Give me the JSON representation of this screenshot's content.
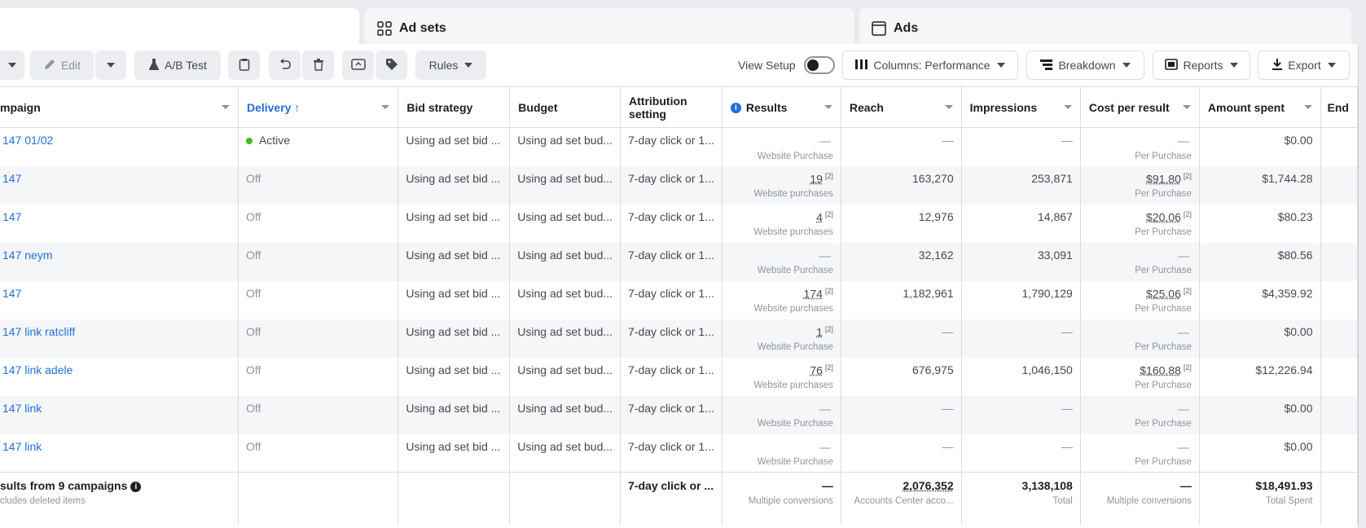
{
  "tabs": {
    "adsets": "Ad sets",
    "ads": "Ads"
  },
  "toolbar": {
    "edit": "Edit",
    "ab_test": "A/B Test",
    "rules": "Rules",
    "view_setup": "View Setup",
    "columns": "Columns: Performance",
    "breakdown": "Breakdown",
    "reports": "Reports",
    "export": "Export"
  },
  "columns": {
    "campaign": "mpaign",
    "delivery": "Delivery",
    "bid_strategy": "Bid strategy",
    "budget": "Budget",
    "attribution": "Attribution setting",
    "results": "Results",
    "reach": "Reach",
    "impressions": "Impressions",
    "cost_per_result": "Cost per result",
    "amount_spent": "Amount spent",
    "ends": "End"
  },
  "rows": [
    {
      "name": "147 01/02",
      "delivery": "Active",
      "bid": "Using ad set bid ...",
      "budget": "Using ad set bud...",
      "attribution": "7-day click or 1...",
      "results": "—",
      "results_sup": "",
      "results_sub": "Website Purchase",
      "reach": "—",
      "impressions": "—",
      "cpr": "—",
      "cpr_sup": "",
      "cpr_sub": "Per Purchase",
      "spent": "$0.00"
    },
    {
      "name": "147",
      "delivery": "Off",
      "bid": "Using ad set bid ...",
      "budget": "Using ad set bud...",
      "attribution": "7-day click or 1...",
      "results": "19",
      "results_sup": "[2]",
      "results_sub": "Website purchases",
      "reach": "163,270",
      "impressions": "253,871",
      "cpr": "$91.80",
      "cpr_sup": "[2]",
      "cpr_sub": "Per Purchase",
      "spent": "$1,744.28"
    },
    {
      "name": "147",
      "delivery": "Off",
      "bid": "Using ad set bid ...",
      "budget": "Using ad set bud...",
      "attribution": "7-day click or 1...",
      "results": "4",
      "results_sup": "[2]",
      "results_sub": "Website purchases",
      "reach": "12,976",
      "impressions": "14,867",
      "cpr": "$20.06",
      "cpr_sup": "[2]",
      "cpr_sub": "Per Purchase",
      "spent": "$80.23"
    },
    {
      "name": "147 neym",
      "delivery": "Off",
      "bid": "Using ad set bid ...",
      "budget": "Using ad set bud...",
      "attribution": "7-day click or 1...",
      "results": "—",
      "results_sup": "",
      "results_sub": "Website Purchase",
      "reach": "32,162",
      "impressions": "33,091",
      "cpr": "—",
      "cpr_sup": "",
      "cpr_sub": "Per Purchase",
      "spent": "$80.56"
    },
    {
      "name": "147",
      "delivery": "Off",
      "bid": "Using ad set bid ...",
      "budget": "Using ad set bud...",
      "attribution": "7-day click or 1...",
      "results": "174",
      "results_sup": "[2]",
      "results_sub": "Website purchases",
      "reach": "1,182,961",
      "impressions": "1,790,129",
      "cpr": "$25.06",
      "cpr_sup": "[2]",
      "cpr_sub": "Per Purchase",
      "spent": "$4,359.92"
    },
    {
      "name": "147 link ratcliff",
      "delivery": "Off",
      "bid": "Using ad set bid ...",
      "budget": "Using ad set bud...",
      "attribution": "7-day click or 1...",
      "results": "1",
      "results_sup": "[2]",
      "results_sub": "Website Purchase",
      "reach": "—",
      "impressions": "—",
      "cpr": "—",
      "cpr_sup": "",
      "cpr_sub": "Per Purchase",
      "spent": "$0.00"
    },
    {
      "name": "147 link adele",
      "delivery": "Off",
      "bid": "Using ad set bid ...",
      "budget": "Using ad set bud...",
      "attribution": "7-day click or 1...",
      "results": "76",
      "results_sup": "[2]",
      "results_sub": "Website purchases",
      "reach": "676,975",
      "impressions": "1,046,150",
      "cpr": "$160.88",
      "cpr_sup": "[2]",
      "cpr_sub": "Per Purchase",
      "spent": "$12,226.94"
    },
    {
      "name": "147 link",
      "delivery": "Off",
      "bid": "Using ad set bid ...",
      "budget": "Using ad set bud...",
      "attribution": "7-day click or 1...",
      "results": "—",
      "results_sup": "",
      "results_sub": "Website Purchase",
      "reach": "—",
      "impressions": "—",
      "cpr": "—",
      "cpr_sup": "",
      "cpr_sub": "Per Purchase",
      "spent": "$0.00"
    },
    {
      "name": "147 link",
      "delivery": "Off",
      "bid": "Using ad set bid ...",
      "budget": "Using ad set bud...",
      "attribution": "7-day click or 1...",
      "results": "—",
      "results_sup": "",
      "results_sub": "Website Purchase",
      "reach": "—",
      "impressions": "—",
      "cpr": "—",
      "cpr_sup": "",
      "cpr_sub": "Per Purchase",
      "spent": "$0.00"
    }
  ],
  "totals": {
    "label": "sults from 9 campaigns",
    "sub": "cludes deleted items",
    "attribution": "7-day click or ...",
    "results": "—",
    "results_sub": "Multiple conversions",
    "reach": "2,076,352",
    "reach_sub": "Accounts Center acco...",
    "impressions": "3,138,108",
    "impressions_sub": "Total",
    "cpr": "—",
    "cpr_sub": "Multiple conversions",
    "spent": "$18,491.93",
    "spent_sub": "Total Spent"
  },
  "colors": {
    "link": "#216fdb",
    "active_dot": "#42b72a",
    "row_alt": "#f5f6f7"
  },
  "icons": [
    "pencil-icon",
    "flask-icon",
    "clipboard-icon",
    "undo-icon",
    "trash-icon",
    "duplicate-icon",
    "tag-icon",
    "columns-icon",
    "breakdown-icon",
    "reports-icon",
    "download-icon",
    "adsets-icon",
    "ads-icon",
    "info-icon",
    "sort-up-icon"
  ]
}
